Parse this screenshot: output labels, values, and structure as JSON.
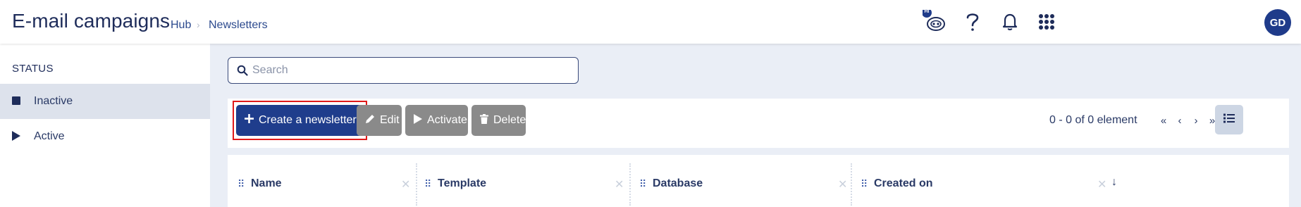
{
  "header": {
    "title": "E-mail campaigns",
    "breadcrumb": [
      "Hub",
      "Newsletters"
    ],
    "notification_badge": "Hi",
    "avatar_initials": "GD"
  },
  "sidebar": {
    "section_title": "STATUS",
    "items": [
      {
        "label": "Inactive",
        "icon": "square-icon",
        "selected": true
      },
      {
        "label": "Active",
        "icon": "play-icon",
        "selected": false
      }
    ]
  },
  "search": {
    "placeholder": "Search",
    "value": ""
  },
  "toolbar": {
    "create_label": "Create a newsletter",
    "edit_label": "Edit",
    "activate_label": "Activate",
    "delete_label": "Delete",
    "pagination_text": "0 - 0 of 0 element"
  },
  "table": {
    "columns": [
      {
        "label": "Name"
      },
      {
        "label": "Template"
      },
      {
        "label": "Database"
      },
      {
        "label": "Created on"
      }
    ]
  },
  "colors": {
    "primary": "#1f3d8c",
    "disabled_button": "#8a8a8a",
    "highlight_border": "#e01a1a",
    "main_background": "#eaeef6"
  }
}
